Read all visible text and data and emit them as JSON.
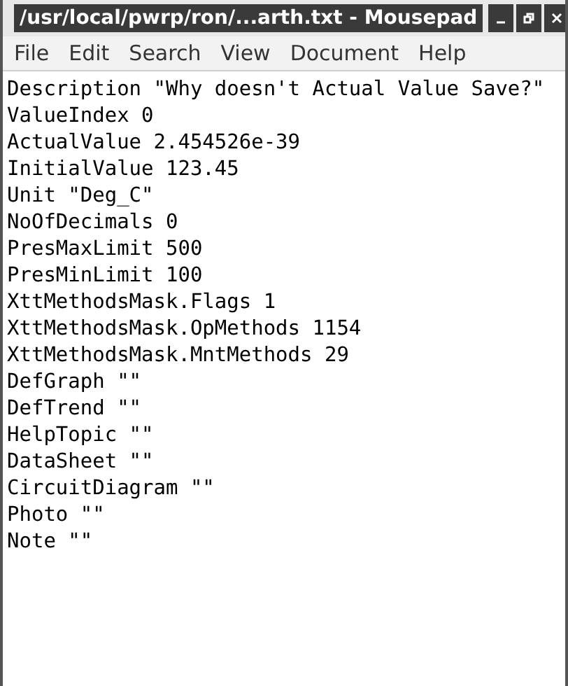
{
  "window": {
    "title": "/usr/local/pwrp/ron/...arth.txt - Mousepad"
  },
  "menu": [
    "File",
    "Edit",
    "Search",
    "View",
    "Document",
    "Help"
  ],
  "lines": [
    "Description \"Why doesn't Actual Value Save?\"",
    "ValueIndex 0",
    "ActualValue 2.454526e-39",
    "InitialValue 123.45",
    "Unit \"Deg_C\"",
    "NoOfDecimals 0",
    "PresMaxLimit 500",
    "PresMinLimit 100",
    "XttMethodsMask.Flags 1",
    "XttMethodsMask.OpMethods 1154",
    "XttMethodsMask.MntMethods 29",
    "DefGraph \"\"",
    "DefTrend \"\"",
    "HelpTopic \"\"",
    "DataSheet \"\"",
    "CircuitDiagram \"\"",
    "Photo \"\"",
    "Note \"\""
  ]
}
